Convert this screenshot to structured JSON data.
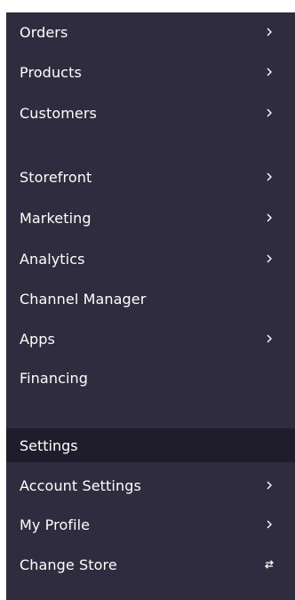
{
  "nav": {
    "orders": "Orders",
    "products": "Products",
    "customers": "Customers",
    "storefront": "Storefront",
    "marketing": "Marketing",
    "analytics": "Analytics",
    "channel_manager": "Channel Manager",
    "apps": "Apps",
    "financing": "Financing"
  },
  "settings": {
    "header": "Settings",
    "account_settings": "Account Settings",
    "my_profile": "My Profile",
    "change_store": "Change Store"
  },
  "colors": {
    "sidebar_bg": "#2f2c3f",
    "active_section_bg": "#1f1d2b",
    "text": "#ffffff"
  },
  "icons": {
    "chevron": "chevron-right-icon",
    "switch": "switch-arrows-icon"
  }
}
